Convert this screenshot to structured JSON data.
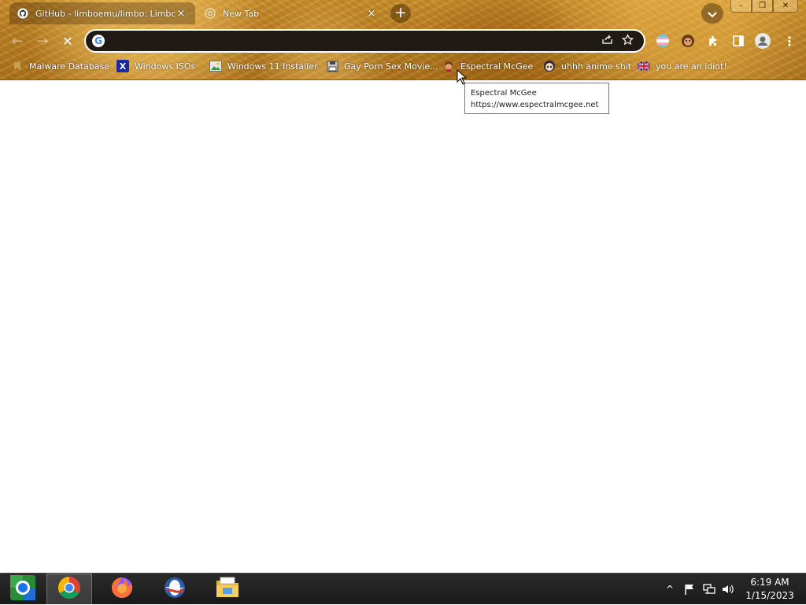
{
  "tabs": [
    {
      "title": "GitHub - limboemu/limbo: Limbo",
      "favicon": "github-icon",
      "close": "×"
    },
    {
      "title": "New Tab",
      "favicon": "new-tab-icon",
      "close": "×"
    }
  ],
  "tab_strip": {
    "new_tab": "+",
    "tab_search": "chevron-down-icon"
  },
  "window_controls": {
    "minimize": "–",
    "maximize": "❐",
    "close": "✕"
  },
  "toolbar": {
    "back": "←",
    "forward": "→",
    "stop": "✕"
  },
  "omnibox": {
    "value": "",
    "placeholder": "",
    "google_letter": "G"
  },
  "bookmarks": [
    {
      "label": "Malware Database",
      "icon": "bookmark-icon"
    },
    {
      "label": "Windows ISOs",
      "icon": "x-icon"
    },
    {
      "label": "Windows 11 Installer",
      "icon": "image-icon"
    },
    {
      "label": "Gay Porn Sex Movie...",
      "icon": "floppy-icon"
    },
    {
      "label": "Espectral McGee",
      "icon": "avatar-icon"
    },
    {
      "label": "uhhh anime shit",
      "icon": "anime-icon"
    },
    {
      "label": "you are an idiot!",
      "icon": "flag-icon"
    }
  ],
  "tooltip": {
    "title": "Espectral McGee",
    "url": "https://www.espectralmcgee.net"
  },
  "taskbar": {
    "apps": [
      "start-orb-icon",
      "chrome-icon",
      "firefox-icon",
      "opera-icon",
      "file-explorer-icon"
    ],
    "tray_arrow": "^",
    "time": "6:19 AM",
    "date": "1/15/2023"
  },
  "colors": {
    "chrome_bg": "#b27a20",
    "omnibox_bg": "#1f1a14",
    "taskbar_bg": "#1a1a1a"
  }
}
